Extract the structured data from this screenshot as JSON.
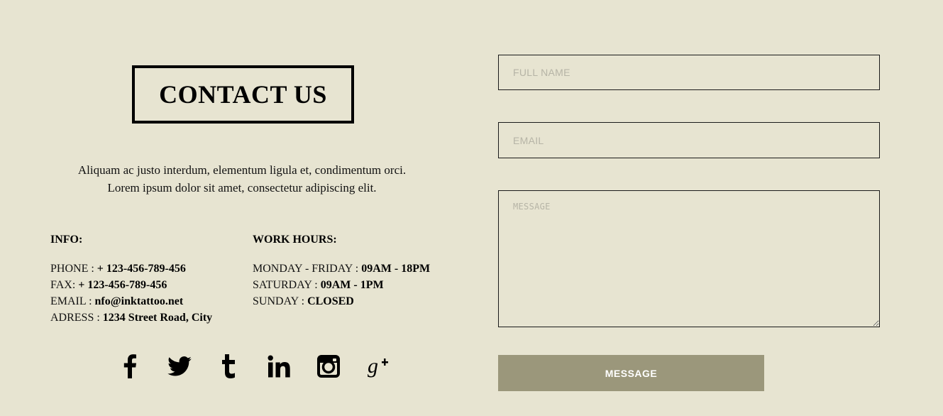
{
  "contact": {
    "title": "CONTACT US",
    "intro_line1": "Aliquam ac justo interdum, elementum ligula et, condimentum orci.",
    "intro_line2": "Lorem ipsum dolor sit amet, consectetur adipiscing elit."
  },
  "info": {
    "title": "INFO:",
    "phone_label": "PHONE : ",
    "phone_value": "+ 123-456-789-456",
    "fax_label": "FAX: ",
    "fax_value": "+ 123-456-789-456",
    "email_label": "EMAIL : ",
    "email_value": "nfo@inktattoo.net",
    "address_label": "ADRESS : ",
    "address_value": "1234 Street Road, City"
  },
  "hours": {
    "title": "WORK HOURS:",
    "weekday_label": "MONDAY - FRIDAY : ",
    "weekday_value": "09AM - 18PM",
    "saturday_label": "SATURDAY : ",
    "saturday_value": "09AM - 1PM",
    "sunday_label": "SUNDAY : ",
    "sunday_value": "CLOSED"
  },
  "social": {
    "icons": [
      "facebook-icon",
      "twitter-icon",
      "tumblr-icon",
      "linkedin-icon",
      "instagram-icon",
      "google-plus-icon"
    ]
  },
  "form": {
    "name_placeholder": "FULL NAME",
    "email_placeholder": "EMAIL",
    "message_placeholder": "MESSAGE",
    "submit_label": "MESSAGE"
  },
  "colors": {
    "background": "#e7e4d1",
    "button": "#9b977b",
    "text": "#111111"
  }
}
